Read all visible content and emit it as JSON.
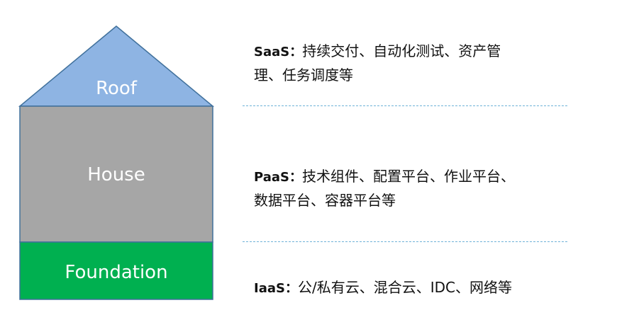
{
  "diagram": {
    "layers": {
      "roof": {
        "label": "Roof",
        "color": "#8eb4e3"
      },
      "house": {
        "label": "House",
        "color": "#a6a6a6"
      },
      "foundation": {
        "label": "Foundation",
        "color": "#00b050"
      }
    },
    "outline_color": "#41719c",
    "descriptions": {
      "saas": {
        "tier": "SaaS：",
        "line1": "持续交付、自动化测试、资产管",
        "line2": "理、任务调度等"
      },
      "paas": {
        "tier": "PaaS：",
        "line1": "技术组件、配置平台、作业平台、",
        "line2": "数据平台、容器平台等"
      },
      "iaas": {
        "tier": "IaaS：",
        "line1": "公/私有云、混合云、IDC、网络等"
      }
    },
    "divider_color": "#6fb3d8"
  }
}
